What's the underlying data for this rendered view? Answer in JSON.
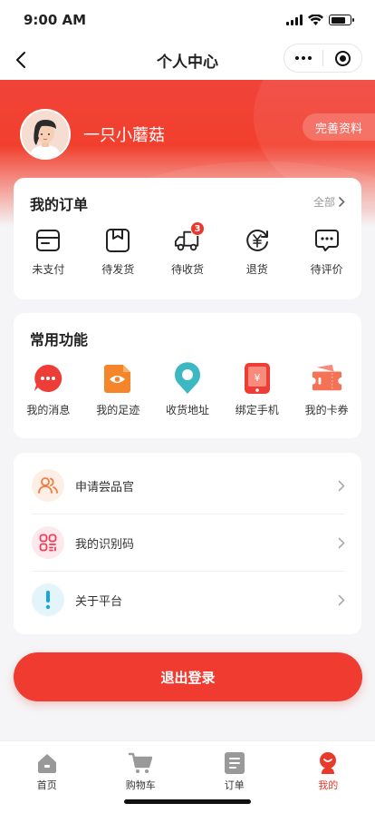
{
  "status": {
    "time": "9:00 AM"
  },
  "nav": {
    "title": "个人中心"
  },
  "profile": {
    "username": "一只小蘑菇",
    "complete_label": "完善资料"
  },
  "orders": {
    "title": "我的订单",
    "all_label": "全部",
    "items": [
      {
        "label": "未支付",
        "icon": "card-icon"
      },
      {
        "label": "待发货",
        "icon": "box-icon"
      },
      {
        "label": "待收货",
        "icon": "truck-icon",
        "badge": "3"
      },
      {
        "label": "退货",
        "icon": "refund-icon"
      },
      {
        "label": "待评价",
        "icon": "comment-icon"
      }
    ]
  },
  "functions": {
    "title": "常用功能",
    "items": [
      {
        "label": "我的消息",
        "icon": "message-icon"
      },
      {
        "label": "我的足迹",
        "icon": "eye-footprint-icon"
      },
      {
        "label": "收货地址",
        "icon": "location-icon"
      },
      {
        "label": "绑定手机",
        "icon": "phone-icon"
      },
      {
        "label": "我的卡券",
        "icon": "coupon-icon"
      }
    ]
  },
  "menu": {
    "items": [
      {
        "label": "申请尝品官",
        "icon": "users-icon"
      },
      {
        "label": "我的识别码",
        "icon": "qrcode-icon"
      },
      {
        "label": "关于平台",
        "icon": "info-icon"
      }
    ]
  },
  "logout_label": "退出登录",
  "tabs": [
    {
      "label": "首页",
      "icon": "home-icon"
    },
    {
      "label": "购物车",
      "icon": "cart-icon"
    },
    {
      "label": "订单",
      "icon": "order-icon"
    },
    {
      "label": "我的",
      "icon": "profile-icon",
      "active": true
    }
  ],
  "colors": {
    "accent": "#e8392c",
    "hero": "#f23f2d",
    "background": "#f5f5f7"
  }
}
